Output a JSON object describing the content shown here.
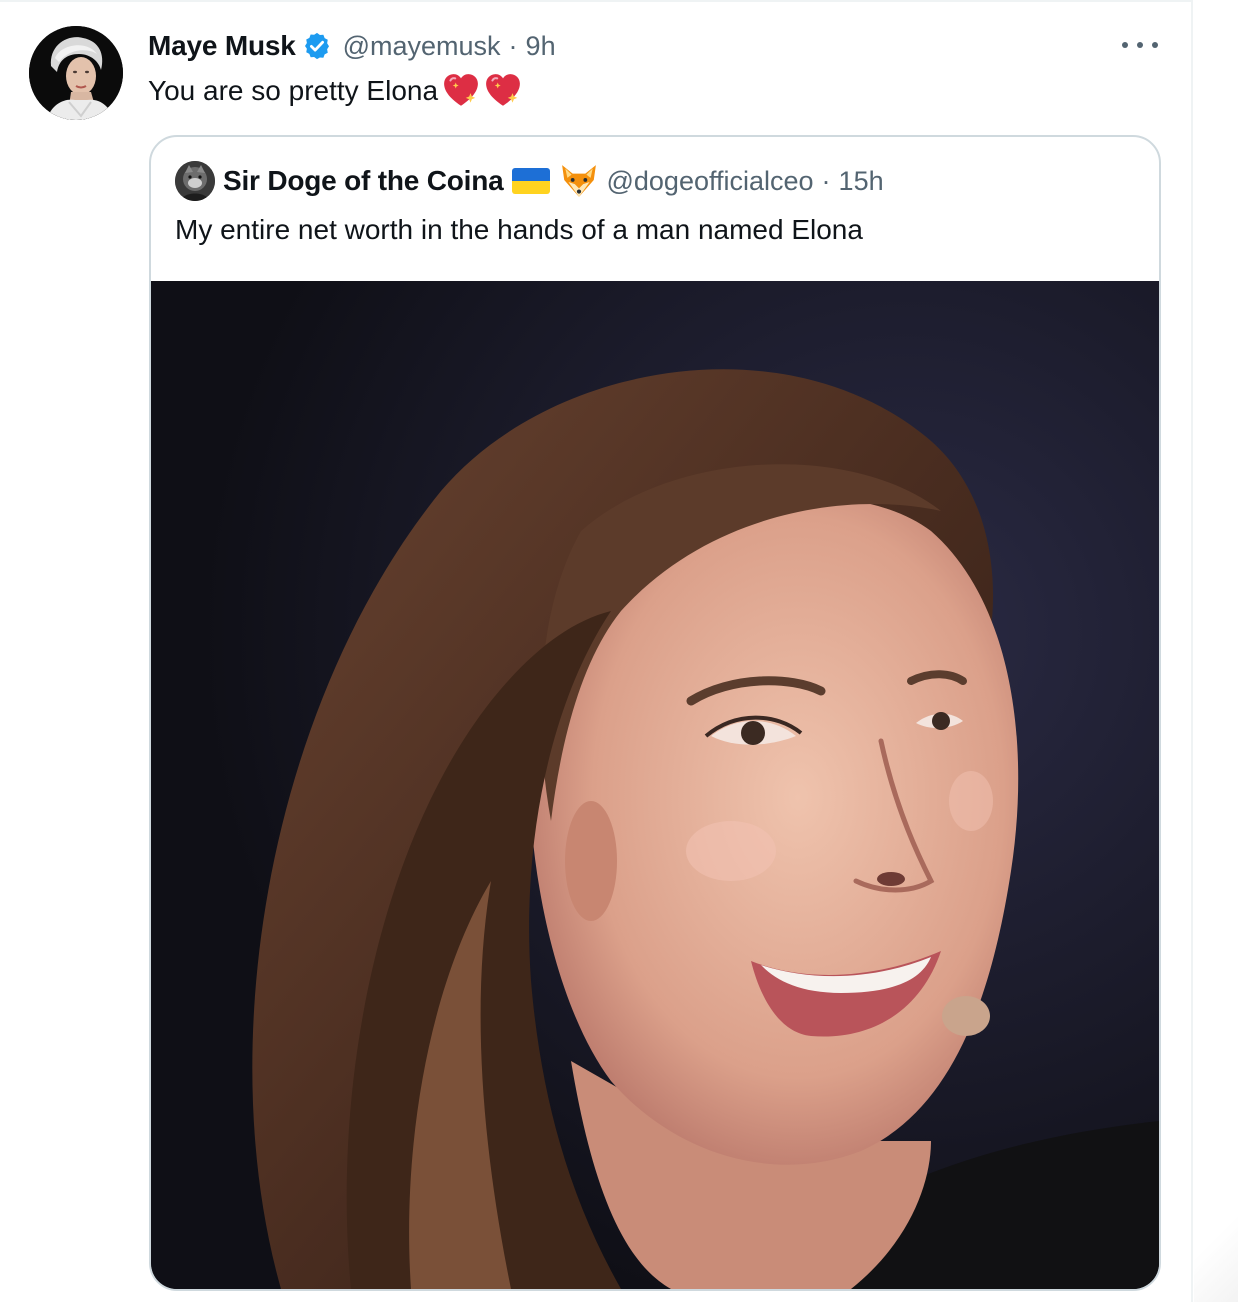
{
  "tweet": {
    "author": {
      "display_name": "Maye Musk",
      "verified": true,
      "handle": "@mayemusk",
      "avatar_icon": "profile-photo"
    },
    "separator": "·",
    "time": "9h",
    "text": "You are so pretty Elona",
    "emojis": [
      "sparkling-heart",
      "sparkling-heart"
    ],
    "more_icon": "more-horizontal-icon"
  },
  "quoted_tweet": {
    "author": {
      "display_name": "Sir Doge of the Coina",
      "name_emojis": [
        "ukraine-flag",
        "fox-face"
      ],
      "handle": "@dogeofficialceo",
      "avatar_icon": "profile-photo"
    },
    "separator": "·",
    "time": "15h",
    "text": "My entire net worth in the hands of a man named Elona",
    "media": {
      "type": "photo",
      "subject": "smiling woman with long brown hair"
    }
  },
  "colors": {
    "verified_blue": "#1d9bf0",
    "text_primary": "#0f1419",
    "text_secondary": "#536471",
    "border": "#cfd9de"
  }
}
